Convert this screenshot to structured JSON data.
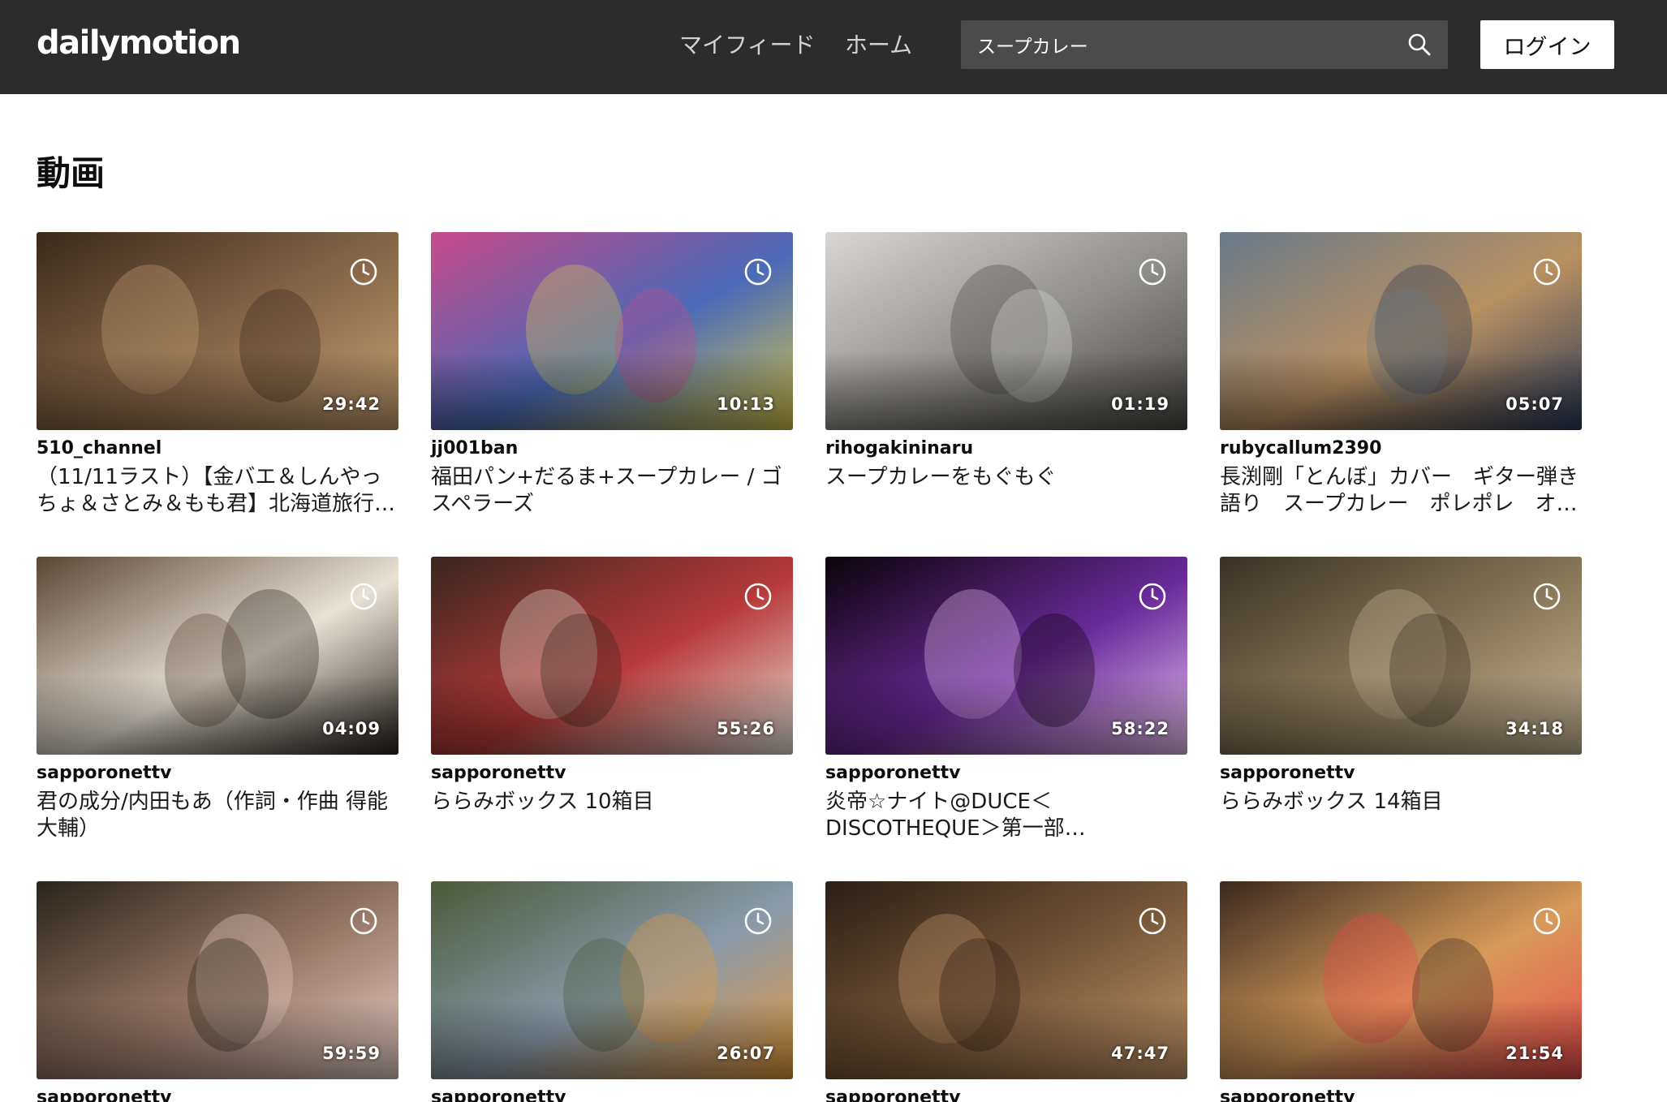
{
  "header": {
    "logo": "dailymotion",
    "nav": {
      "feed": "マイフィード",
      "home": "ホーム"
    },
    "search": {
      "value": "スープカレー"
    },
    "login_label": "ログイン"
  },
  "main": {
    "section_title": "動画"
  },
  "videos": [
    {
      "channel": "510_channel",
      "title": "（11/11ラスト）【金バエ＆しんやっちょ＆さとみ＆もも君】北海道旅行…",
      "duration": "29:42"
    },
    {
      "channel": "jj001ban",
      "title": "福田パン+だるま+スープカレー / ゴスペラーズ",
      "duration": "10:13"
    },
    {
      "channel": "rihogakininaru",
      "title": "スープカレーをもぐもぐ",
      "duration": "01:19"
    },
    {
      "channel": "rubycallum2390",
      "title": "長渕剛「とんぼ」カバー　ギター弾き語り　スープカレー　ポレポレ　オ…",
      "duration": "05:07"
    },
    {
      "channel": "sapporonettv",
      "title": "君の成分/内田もあ（作詞・作曲 得能大輔）",
      "duration": "04:09"
    },
    {
      "channel": "sapporonettv",
      "title": "ららみボックス 10箱目",
      "duration": "55:26"
    },
    {
      "channel": "sapporonettv",
      "title": "炎帝☆ナイト@DUCE＜DISCOTHEQUE＞第一部…",
      "duration": "58:22"
    },
    {
      "channel": "sapporonettv",
      "title": "ららみボックス 14箱目",
      "duration": "34:18"
    },
    {
      "channel": "sapporonettv",
      "title": "",
      "duration": "59:59"
    },
    {
      "channel": "sapporonettv",
      "title": "",
      "duration": "26:07"
    },
    {
      "channel": "sapporonettv",
      "title": "",
      "duration": "47:47"
    },
    {
      "channel": "sapporonettv",
      "title": "",
      "duration": "21:54"
    }
  ],
  "icons": {
    "search": "search-icon",
    "watch_later": "clock-icon"
  },
  "colors": {
    "header_bg": "#2c2c2c",
    "search_bg": "#4b4b4b",
    "login_bg": "#ffffff"
  }
}
